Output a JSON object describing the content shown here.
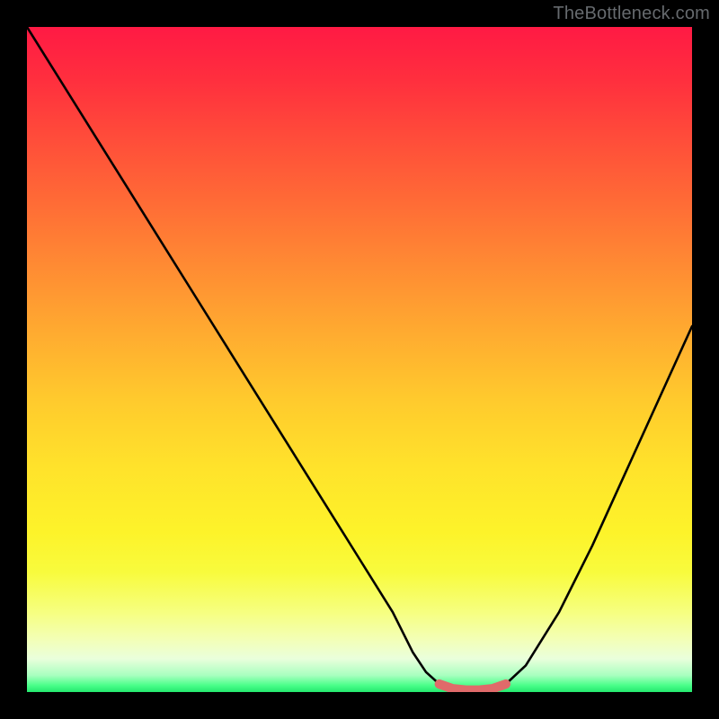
{
  "watermark": "TheBottleneck.com",
  "chart_data": {
    "type": "line",
    "title": "",
    "xlabel": "",
    "ylabel": "",
    "xlim": [
      0,
      100
    ],
    "ylim": [
      0,
      100
    ],
    "grid": false,
    "series": [
      {
        "name": "bottleneck-curve",
        "x": [
          0,
          5,
          10,
          15,
          20,
          25,
          30,
          35,
          40,
          45,
          50,
          55,
          58,
          60,
          62,
          64,
          66,
          68,
          70,
          72,
          75,
          80,
          85,
          90,
          95,
          100
        ],
        "y": [
          100,
          92,
          84,
          76,
          68,
          60,
          52,
          44,
          36,
          28,
          20,
          12,
          6,
          3,
          1.2,
          0.5,
          0.3,
          0.3,
          0.5,
          1.2,
          4,
          12,
          22,
          33,
          44,
          55
        ]
      },
      {
        "name": "optimal-zone",
        "x": [
          62,
          64,
          66,
          68,
          70,
          72
        ],
        "y": [
          1.2,
          0.5,
          0.3,
          0.3,
          0.5,
          1.2
        ]
      }
    ],
    "background_gradient": {
      "top": "#ff1a44",
      "upper_mid": "#ffca2d",
      "lower_mid": "#f8fb3d",
      "bottom": "#25e86e"
    },
    "colors": {
      "curve": "#000000",
      "optimal_zone_stroke": "#e06a6a",
      "frame": "#000000"
    }
  }
}
